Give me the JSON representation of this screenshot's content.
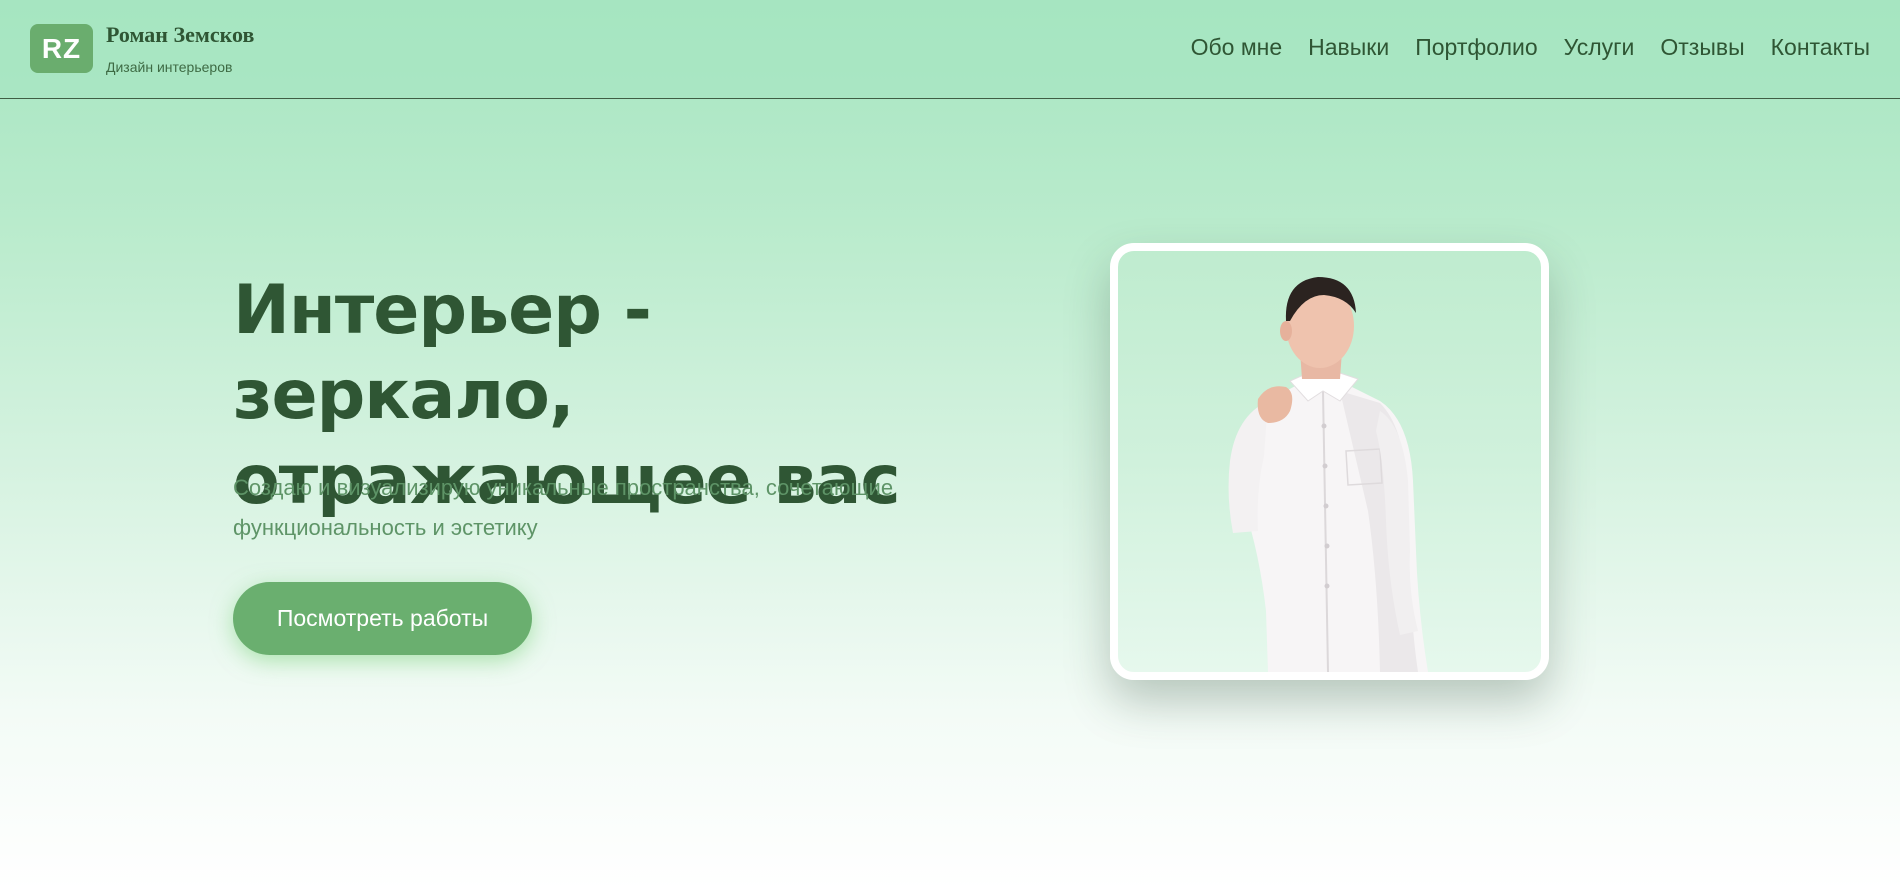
{
  "brand": {
    "logo_text": "RZ",
    "name": "Роман Земсков",
    "subtitle": "Дизайн интерьеров"
  },
  "nav": {
    "items": [
      {
        "label": "Обо мне"
      },
      {
        "label": "Навыки"
      },
      {
        "label": "Портфолио"
      },
      {
        "label": "Услуги"
      },
      {
        "label": "Отзывы"
      },
      {
        "label": "Контакты"
      }
    ]
  },
  "hero": {
    "title_line1": "Интерьер - зеркало,",
    "title_line2": "отражающее вас",
    "subtitle_line1": "Создаю и визуализирую уникальные пространства, сочетающие",
    "subtitle_line2": "функциональность и эстетику",
    "cta_label": "Посмотреть работы"
  },
  "colors": {
    "accent": "#6aaf6f",
    "text_dark": "#2f5634",
    "text_muted": "#5e9467",
    "background_top": "#a6e5c1"
  }
}
